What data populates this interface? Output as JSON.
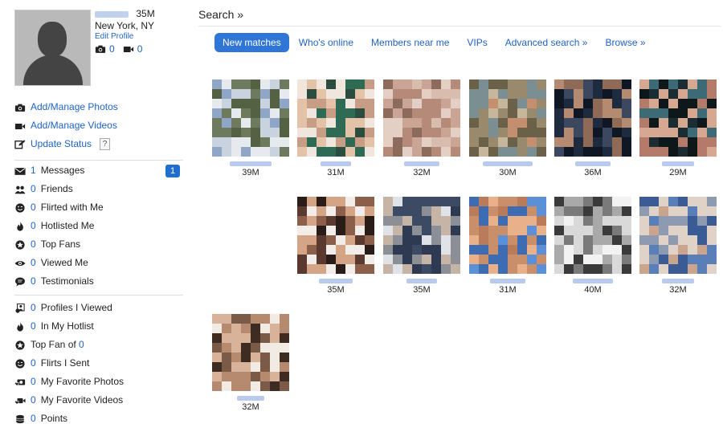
{
  "profile": {
    "age_sex": "35M",
    "location": "New York, NY",
    "edit_label": "Edit Profile",
    "photo_count": "0",
    "video_count": "0"
  },
  "actions": [
    {
      "label": "Add/Manage Photos",
      "icon": "camera-icon"
    },
    {
      "label": "Add/Manage Videos",
      "icon": "video-camera-icon"
    },
    {
      "label": "Update Status",
      "icon": "edit-icon",
      "help": "?"
    }
  ],
  "inbox": [
    {
      "count": "1",
      "label": "Messages",
      "icon": "envelope-icon",
      "badge": "1"
    },
    {
      "count": "0",
      "label": "Friends",
      "icon": "friends-icon"
    },
    {
      "count": "0",
      "label": "Flirted with Me",
      "icon": "wink-icon"
    },
    {
      "count": "0",
      "label": "Hotlisted Me",
      "icon": "flame-icon"
    },
    {
      "count": "0",
      "label": "Top Fans",
      "icon": "star-badge-icon"
    },
    {
      "count": "0",
      "label": "Viewed Me",
      "icon": "eye-icon"
    },
    {
      "count": "0",
      "label": "Testimonials",
      "icon": "speech-bubble-icon"
    }
  ],
  "activity": [
    {
      "pre": "",
      "count": "0",
      "label": "Profiles I Viewed",
      "icon": "profiles-viewed-icon"
    },
    {
      "pre": "",
      "count": "0",
      "label": "In My Hotlist",
      "icon": "flame-icon"
    },
    {
      "pre": "Top Fan of ",
      "count": "0",
      "label": "",
      "icon": "star-badge-icon"
    },
    {
      "pre": "",
      "count": "0",
      "label": "Flirts I Sent",
      "icon": "wink-icon"
    },
    {
      "pre": "",
      "count": "0",
      "label": "My Favorite Photos",
      "icon": "favorite-photos-icon"
    },
    {
      "pre": "",
      "count": "0",
      "label": "My Favorite Videos",
      "icon": "favorite-videos-icon"
    },
    {
      "pre": "",
      "count": "0",
      "label": "Points",
      "icon": "points-icon"
    }
  ],
  "search": {
    "title": "Search »",
    "tabs": [
      {
        "label": "New matches",
        "active": true
      },
      {
        "label": "Who's online",
        "active": false
      },
      {
        "label": "Members near me",
        "active": false
      },
      {
        "label": "VIPs",
        "active": false
      },
      {
        "label": "Advanced search »",
        "active": false
      },
      {
        "label": "Browse »",
        "active": false
      }
    ]
  },
  "matches": [
    {
      "age": "39M",
      "colors": [
        "#8fa6c6",
        "#c9d3df",
        "#e6e9ee",
        "#6d7a5e",
        "#556143"
      ]
    },
    {
      "age": "31M",
      "colors": [
        "#2f6a55",
        "#e3c2a8",
        "#c79d86",
        "#2b4d3f",
        "#f0e6de"
      ]
    },
    {
      "age": "32M",
      "colors": [
        "#caa596",
        "#b68a79",
        "#d8bcad",
        "#8c6b5d",
        "#e4cfc5"
      ]
    },
    {
      "age": "30M",
      "colors": [
        "#9a8a6d",
        "#c6b79c",
        "#6b6048",
        "#c48f6f",
        "#7b8e92"
      ]
    },
    {
      "age": "36M",
      "colors": [
        "#1e2a3d",
        "#b48b70",
        "#3b4860",
        "#8e6a57",
        "#0f1624"
      ]
    },
    {
      "age": "29M",
      "colors": [
        "#1b2d33",
        "#d7a891",
        "#3c6b76",
        "#b57b6a",
        "#0e171a"
      ]
    },
    {
      "age": "35M",
      "colors": [
        "#2a1c18",
        "#d4a487",
        "#8c5f4a",
        "#f2ede9",
        "#5a3a2e"
      ]
    },
    {
      "age": "35M",
      "colors": [
        "#dfe2e6",
        "#3c4a63",
        "#8c8f95",
        "#2e3a52",
        "#c6b5a6"
      ]
    },
    {
      "age": "31M",
      "colors": [
        "#5b8fd6",
        "#c98f6b",
        "#e8b18a",
        "#3d6cb2",
        "#b97b5a"
      ]
    },
    {
      "age": "40M",
      "colors": [
        "#d9d9d9",
        "#7a7a7a",
        "#3a3a3a",
        "#a9a9a9",
        "#f2f2f2"
      ]
    },
    {
      "age": "32M",
      "colors": [
        "#5a7fb8",
        "#c9a58e",
        "#3b5b95",
        "#8e9ab0",
        "#e0d2c6"
      ]
    },
    {
      "age": "32M",
      "colors": [
        "#7b5a47",
        "#d8b39a",
        "#b68a6e",
        "#f1ebe4",
        "#3e2c22"
      ]
    }
  ],
  "colors": {
    "link": "#1f63c6",
    "active_tab": "#2f76d6",
    "badge": "#1f6fd1"
  }
}
